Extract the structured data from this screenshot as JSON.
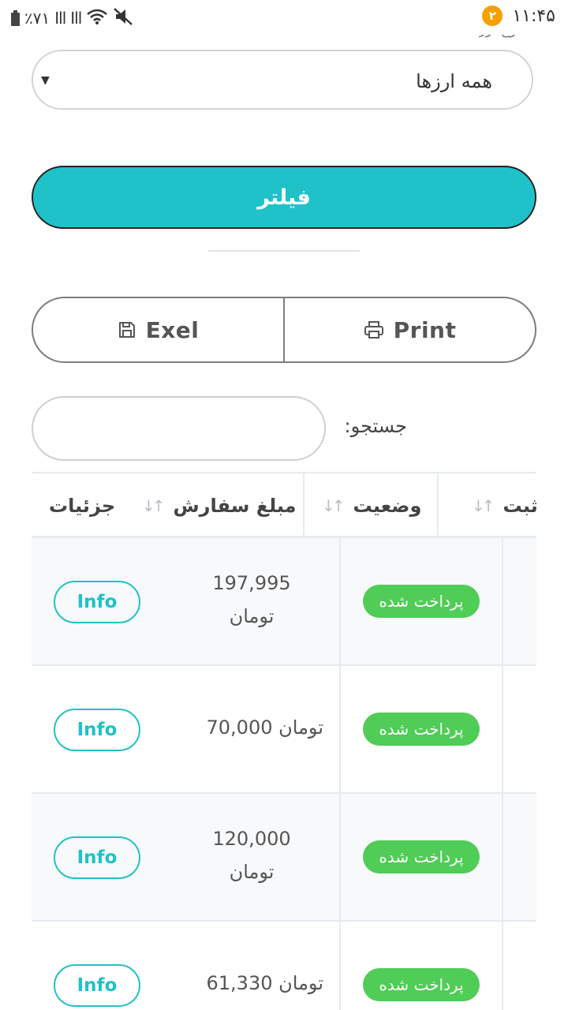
{
  "status_bar": {
    "battery_percent": "٪۷۱",
    "signal_1": "Ill",
    "signal_2": "Ill",
    "notification_count": "۲",
    "time": "۱۱:۴۵"
  },
  "filter_form": {
    "currency_label_partial": "نوع ارز",
    "currency_select_value": "همه ارزها",
    "filter_button_label": "فیلتر"
  },
  "export": {
    "excel_label": "Exel",
    "print_label": "Print"
  },
  "search": {
    "label": "جستجو:",
    "value": ""
  },
  "table": {
    "columns": [
      {
        "label": "تاریخ ثبت"
      },
      {
        "label": "وضعیت"
      },
      {
        "label": "مبلغ سفارش"
      },
      {
        "label": "جزئیات"
      }
    ],
    "rows": [
      {
        "status": "پرداخت شده",
        "amount_line1": "197,995",
        "amount_line2": "تومان",
        "action": "Info"
      },
      {
        "status": "پرداخت شده",
        "amount_line1": "70,000 تومان",
        "amount_line2": "",
        "action": "Info"
      },
      {
        "status": "پرداخت شده",
        "amount_line1": "120,000",
        "amount_line2": "تومان",
        "action": "Info"
      },
      {
        "status": "پرداخت شده",
        "amount_line1": "61,330 تومان",
        "amount_line2": "",
        "action": "Info"
      }
    ]
  },
  "colors": {
    "accent": "#1ec2c8",
    "status_paid": "#4fcd56",
    "notification": "#f5a000"
  }
}
